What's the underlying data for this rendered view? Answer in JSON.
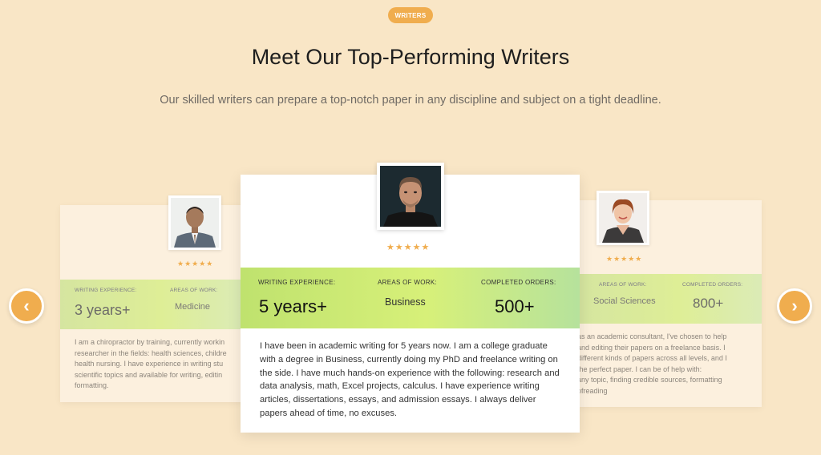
{
  "section": {
    "badge": "WRITERS",
    "title": "Meet Our Top-Performing Writers",
    "subtitle": "Our skilled writers can prepare a top-notch paper in any discipline and subject on a tight deadline."
  },
  "rating_symbol": "★★★★★",
  "writers": {
    "left": {
      "rating": 5,
      "label_experience": "WRITING EXPERIENCE:",
      "label_area": "AREAS OF WORK:",
      "experience": "3 years+",
      "area": "Medicine",
      "bio_lines": [
        "I am a chiropractor by training, currently workin",
        "researcher in the fields: health sciences, childre",
        "health nursing. I have experience in writing stu",
        "scientific topics and available for writing, editin",
        "formatting."
      ]
    },
    "center": {
      "rating": 5,
      "label_experience": "WRITING EXPERIENCE:",
      "label_area": "AREAS OF WORK:",
      "label_orders": "COMPLETED ORDERS:",
      "experience": "5 years+",
      "area": "Business",
      "orders": "500+",
      "bio": "I have been in academic writing for 5 years now. I am a college graduate with a degree in Business, currently doing my PhD and freelance writing on the side. I have much hands-on experience with the following: research and data analysis, math, Excel projects, calculus. I have experience writing articles, dissertations, essays, and admission essays. I always deliver papers ahead of time, no excuses."
    },
    "right": {
      "rating": 5,
      "label_area": "AREAS OF WORK:",
      "label_orders": "COMPLETED ORDERS:",
      "area": "Social Sciences",
      "orders": "800+",
      "bio_lines": [
        "as an academic consultant, I've chosen to help",
        " and editing their papers on a freelance basis. I",
        " different kinds of papers across all levels, and I",
        " the perfect paper. I can be of help with:",
        "any topic, finding credible sources, formatting",
        "ofreading"
      ]
    }
  },
  "nav": {
    "prev": "‹",
    "next": "›"
  },
  "colors": {
    "accent": "#f0ad4e",
    "background": "#f9e6c6"
  }
}
